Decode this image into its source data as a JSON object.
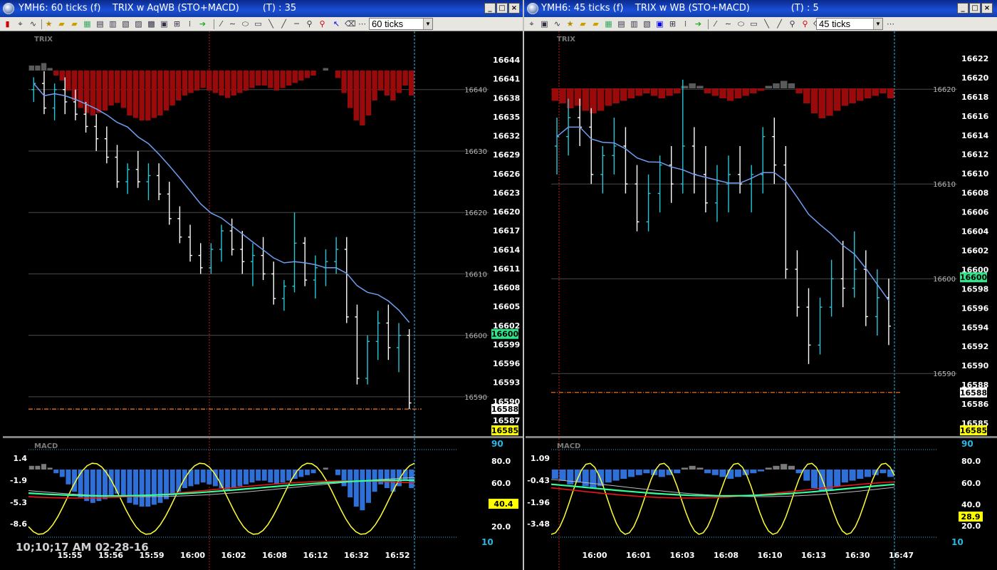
{
  "colors": {
    "background": "#000000",
    "bar_up": "#23c8d8",
    "bar_down": "#ffffff",
    "trix_neg": "#9a0a0a",
    "trix_pos": "#5a5a5a",
    "ma_line": "#6f9df0",
    "macd_neg": "#2f6fd8",
    "macd_pos": "#7a7a7a",
    "signal": "#ffff33",
    "fast": "#33ff99",
    "slow": "#e81818",
    "grey_line": "#bbbbbb",
    "ref_line": "#ff7a1e",
    "cyan_line": "#26b8e6",
    "red_marker": "#c81818",
    "label_green": "#33e38a",
    "label_yellow": "#ffff00"
  },
  "left_window": {
    "title": "YMH6: 60 ticks (f)    TRIX w AqWB (STO+MACD)        (T) : 35",
    "ticks_select": "60 ticks",
    "trix_label": "TRIX",
    "macd_label": "MACD",
    "timestamp": "10;10;17 AM  02-28-16",
    "min_btn": "_",
    "max_btn": "□",
    "close_btn": "×",
    "price_scale": [
      "16644",
      "16641",
      "16638",
      "16635",
      "16632",
      "16629",
      "16626",
      "16623",
      "16620",
      "16617",
      "16614",
      "16611",
      "16608",
      "16605",
      "16602",
      "16599",
      "16596",
      "16593",
      "16590",
      "16587"
    ],
    "grid_labels": [
      "16640",
      "16630",
      "16620",
      "16610",
      "16600",
      "16590"
    ],
    "price_tags": [
      "16600",
      "16588",
      "16585"
    ],
    "macd_axis_left": [
      "1.4",
      "-1.9",
      "-5.3",
      "-8.6"
    ],
    "macd_axis_right": [
      "90",
      "80.0",
      "60.0",
      "40.4",
      "20.0",
      "10"
    ],
    "time_labels": [
      "15:55",
      "15:56",
      "15:59",
      "16:00",
      "16:02",
      "16:08",
      "16:12",
      "16:32",
      "16:52"
    ]
  },
  "right_window": {
    "title": "YMH6: 45 ticks (f)    TRIX w WB (STO+MACD)              (T) : 5",
    "ticks_select": "45 ticks",
    "trix_label": "TRIX",
    "macd_label": "MACD",
    "min_btn": "_",
    "max_btn": "□",
    "close_btn": "×",
    "price_scale": [
      "16622",
      "16620",
      "16618",
      "16616",
      "16614",
      "16612",
      "16610",
      "16608",
      "16606",
      "16604",
      "16602",
      "16600",
      "16598",
      "16596",
      "16594",
      "16592",
      "16590",
      "16588",
      "16586",
      "16585"
    ],
    "grid_labels": [
      "16620",
      "16610",
      "16600",
      "16590"
    ],
    "price_tags": [
      "16600",
      "16588",
      "16585"
    ],
    "macd_axis_left": [
      "1.09",
      "-0.43",
      "-1.96",
      "-3.48"
    ],
    "macd_axis_right": [
      "90",
      "80.0",
      "60.0",
      "40.0",
      "28.9",
      "20.0",
      "10"
    ],
    "time_labels": [
      "16:00",
      "16:01",
      "16:03",
      "16:08",
      "16:10",
      "16:13",
      "16:30",
      "16:47"
    ]
  },
  "chart_data": [
    {
      "type": "candlestick",
      "title": "YMH6: 60 ticks (f)",
      "ylim": [
        16585,
        16646
      ],
      "bars": [
        [
          16640,
          16642,
          16638,
          16641
        ],
        [
          16641,
          16643,
          16636,
          16637
        ],
        [
          16637,
          16641,
          16635,
          16640
        ],
        [
          16640,
          16642,
          16636,
          16638
        ],
        [
          16638,
          16640,
          16635,
          16636
        ],
        [
          16636,
          16638,
          16633,
          16634
        ],
        [
          16634,
          16636,
          16630,
          16632
        ],
        [
          16632,
          16634,
          16628,
          16629
        ],
        [
          16629,
          16631,
          16624,
          16625
        ],
        [
          16625,
          16628,
          16623,
          16627
        ],
        [
          16627,
          16630,
          16624,
          16625
        ],
        [
          16625,
          16628,
          16622,
          16626
        ],
        [
          16626,
          16628,
          16622,
          16623
        ],
        [
          16623,
          16625,
          16618,
          16619
        ],
        [
          16619,
          16621,
          16615,
          16616
        ],
        [
          16616,
          16618,
          16612,
          16613
        ],
        [
          16613,
          16615,
          16610,
          16611
        ],
        [
          16611,
          16615,
          16610,
          16614
        ],
        [
          16614,
          16618,
          16612,
          16617
        ],
        [
          16617,
          16619,
          16613,
          16614
        ],
        [
          16614,
          16617,
          16610,
          16612
        ],
        [
          16612,
          16615,
          16608,
          16613
        ],
        [
          16613,
          16616,
          16609,
          16610
        ],
        [
          16610,
          16612,
          16605,
          16606
        ],
        [
          16606,
          16609,
          16604,
          16608
        ],
        [
          16608,
          16620,
          16607,
          16615
        ],
        [
          16615,
          16616,
          16608,
          16609
        ],
        [
          16609,
          16613,
          16606,
          16611
        ],
        [
          16611,
          16614,
          16608,
          16612
        ],
        [
          16612,
          16616,
          16610,
          16614
        ],
        [
          16614,
          16616,
          16602,
          16603
        ],
        [
          16603,
          16605,
          16592,
          16593
        ],
        [
          16593,
          16600,
          16592,
          16599
        ],
        [
          16599,
          16604,
          16596,
          16602
        ],
        [
          16602,
          16605,
          16596,
          16598
        ],
        [
          16598,
          16602,
          16594,
          16600
        ],
        [
          16600,
          16601,
          16588,
          16589
        ]
      ],
      "trix_hist": [
        2,
        2,
        3,
        1,
        -2,
        -4,
        -8,
        -12,
        -15,
        -17,
        -18,
        -17,
        -16,
        -14,
        -13,
        -15,
        -18,
        -19,
        -20,
        -20,
        -19,
        -18,
        -16,
        -14,
        -12,
        -10,
        -9,
        -8,
        -7,
        -8,
        -9,
        -10,
        -11,
        -10,
        -9,
        -8,
        -7,
        -6,
        -6,
        -7,
        -8,
        -7,
        -6,
        -5,
        -4,
        -3,
        -2,
        0,
        1,
        0,
        -3,
        -9,
        -15,
        -20,
        -22,
        -18,
        -12,
        -8,
        -10,
        -12,
        -9,
        -6,
        -10
      ]
    },
    {
      "type": "candlestick",
      "title": "YMH6: 45 ticks (f)",
      "ylim": [
        16584,
        16624
      ],
      "bars": [
        [
          16614,
          16617,
          16611,
          16615
        ],
        [
          16615,
          16619,
          16613,
          16617
        ],
        [
          16617,
          16619,
          16614,
          16616
        ],
        [
          16616,
          16618,
          16610,
          16611
        ],
        [
          16611,
          16614,
          16609,
          16613
        ],
        [
          16613,
          16617,
          16611,
          16614
        ],
        [
          16614,
          16616,
          16609,
          16610
        ],
        [
          16610,
          16612,
          16605,
          16606
        ],
        [
          16606,
          16611,
          16605,
          16609
        ],
        [
          16609,
          16613,
          16607,
          16612
        ],
        [
          16612,
          16614,
          16608,
          16610
        ],
        [
          16610,
          16621,
          16609,
          16614
        ],
        [
          16614,
          16616,
          16609,
          16611
        ],
        [
          16611,
          16614,
          16607,
          16608
        ],
        [
          16608,
          16612,
          16606,
          16610
        ],
        [
          16610,
          16613,
          16607,
          16611
        ],
        [
          16611,
          16614,
          16609,
          16610
        ],
        [
          16610,
          16612,
          16607,
          16611
        ],
        [
          16611,
          16616,
          16609,
          16615
        ],
        [
          16615,
          16617,
          16610,
          16612
        ],
        [
          16612,
          16614,
          16600,
          16601
        ],
        [
          16601,
          16603,
          16596,
          16597
        ],
        [
          16597,
          16599,
          16591,
          16593
        ],
        [
          16593,
          16598,
          16592,
          16597
        ],
        [
          16597,
          16602,
          16596,
          16600
        ],
        [
          16600,
          16604,
          16597,
          16599
        ],
        [
          16599,
          16605,
          16598,
          16601
        ],
        [
          16601,
          16603,
          16595,
          16596
        ],
        [
          16596,
          16601,
          16594,
          16598
        ],
        [
          16598,
          16600,
          16593,
          16595
        ]
      ],
      "trix_hist": [
        -5,
        -6,
        -8,
        -7,
        -9,
        -10,
        -9,
        -7,
        -6,
        -5,
        -4,
        -3,
        -2,
        -3,
        -4,
        -3,
        -2,
        1,
        2,
        1,
        -2,
        -3,
        -4,
        -5,
        -4,
        -3,
        -2,
        -1,
        1,
        2,
        3,
        2,
        -2,
        -6,
        -10,
        -12,
        -11,
        -9,
        -7,
        -6,
        -5,
        -4,
        -3,
        -2,
        -4
      ]
    }
  ]
}
